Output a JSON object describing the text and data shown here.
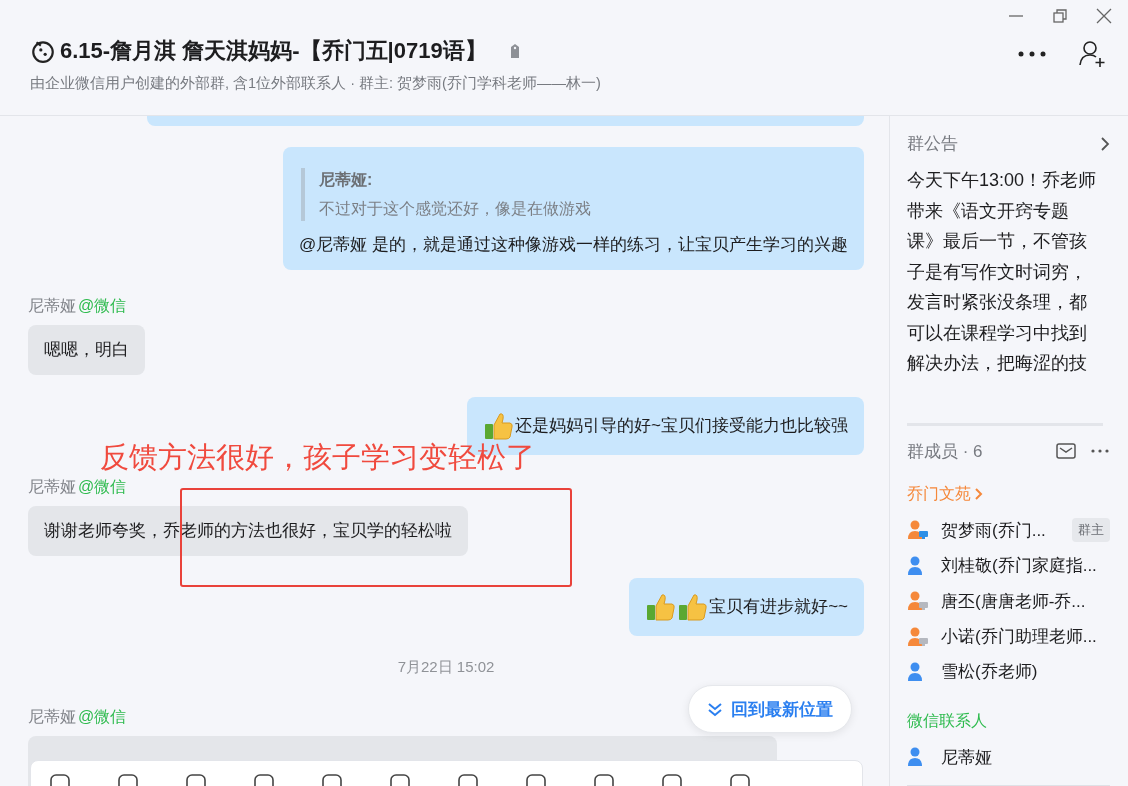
{
  "window": {
    "title": "6.15-詹月淇 詹天淇妈妈-【乔门五|0719语】",
    "subtitle": "由企业微信用户创建的外部群, 含1位外部联系人 · 群主: 贺梦雨(乔门学科老师——林一)"
  },
  "messages": [
    {
      "kind": "partial",
      "outgoing": true
    },
    {
      "kind": "quote",
      "outgoing": true,
      "quote_sender": "尼蒂娅:",
      "quote_text": "不过对于这个感觉还好，像是在做游戏",
      "text": "@尼蒂娅 是的，就是通过这种像游戏一样的练习，让宝贝产生学习的兴趣"
    },
    {
      "kind": "text",
      "outgoing": false,
      "sender": "尼蒂娅",
      "source": "@微信",
      "text": "嗯嗯，明白"
    },
    {
      "kind": "text",
      "outgoing": true,
      "emoji": [
        {
          "kind": "thumbs_up"
        }
      ],
      "text": "还是妈妈引导的好~宝贝们接受能力也比较强"
    },
    {
      "kind": "text",
      "outgoing": false,
      "sender": "尼蒂娅",
      "source": "@微信",
      "text": "谢谢老师夸奖，乔老师的方法也很好，宝贝学的轻松啦"
    },
    {
      "kind": "text",
      "outgoing": true,
      "emoji": [
        {
          "kind": "thumbs_up"
        },
        {
          "kind": "thumbs_up"
        }
      ],
      "text": "宝贝有进步就好~~"
    },
    {
      "kind": "time",
      "text": "7月22日 15:02"
    },
    {
      "kind": "cut",
      "outgoing": false,
      "sender": "尼蒂娅",
      "source": "@微信"
    }
  ],
  "annotation": {
    "text": "反馈方法很好，孩子学习变轻松了"
  },
  "jump_button": {
    "label": "回到最新位置"
  },
  "announcement": {
    "title": "群公告",
    "text": "今天下午13:00！乔老师带来《语文开窍专题课》最后一节，不管孩子是有写作文时词穷，发言时紧张没条理，都可以在课程学习中找到解决办法，把晦涩的技"
  },
  "members": {
    "title": "群成员 · 6",
    "groups": [
      {
        "name": "乔门文苑",
        "color": "#f5883a",
        "expandable": true,
        "items": [
          {
            "name": "贺梦雨(乔门...",
            "kind": "staff_online",
            "badge": "群主"
          },
          {
            "name": "刘桂敬(乔门家庭指...",
            "kind": "contact"
          },
          {
            "name": "唐丕(唐唐老师-乔...",
            "kind": "staff_offline"
          },
          {
            "name": "小诺(乔门助理老师...",
            "kind": "staff_offline"
          },
          {
            "name": "雪松(乔老师)",
            "kind": "contact"
          }
        ]
      },
      {
        "name": "微信联系人",
        "color": "#2fbb4f",
        "expandable": false,
        "items": [
          {
            "name": "尼蒂娅",
            "kind": "contact"
          }
        ]
      }
    ]
  }
}
